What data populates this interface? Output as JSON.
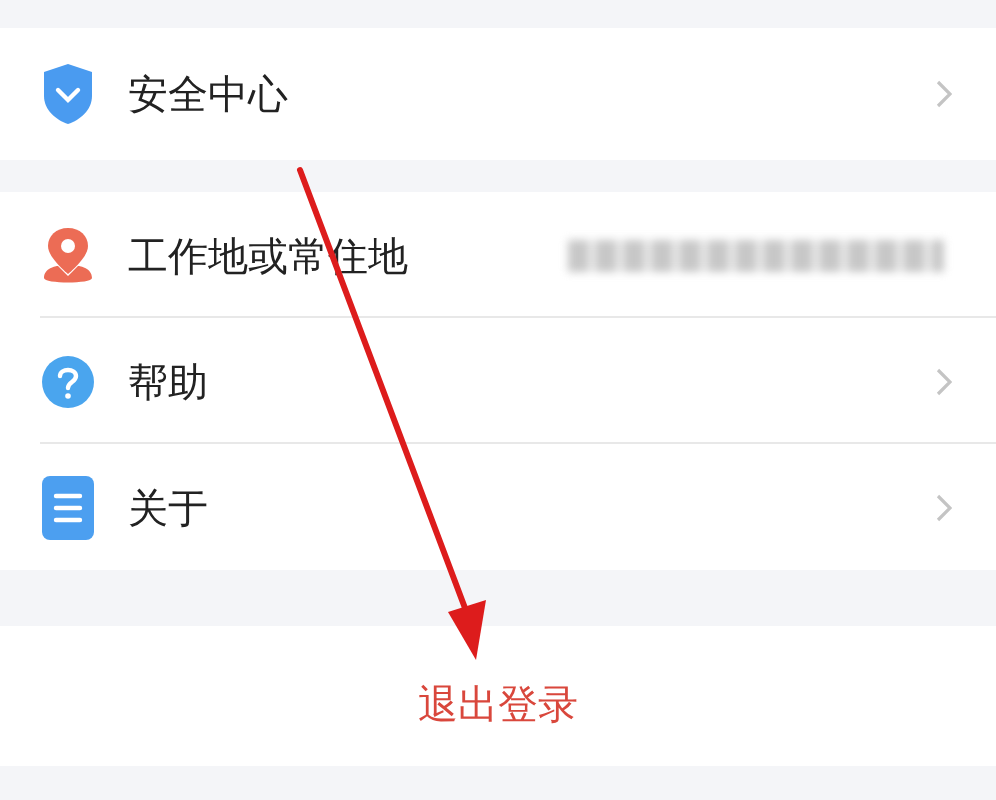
{
  "groups": [
    {
      "items": [
        {
          "label": "安全中心",
          "value_redacted": false
        }
      ]
    },
    {
      "items": [
        {
          "label": "工作地或常住地",
          "value_redacted": true
        },
        {
          "label": "帮助",
          "value_redacted": false
        },
        {
          "label": "关于",
          "value_redacted": false
        }
      ]
    }
  ],
  "logout": {
    "label": "退出登录"
  }
}
